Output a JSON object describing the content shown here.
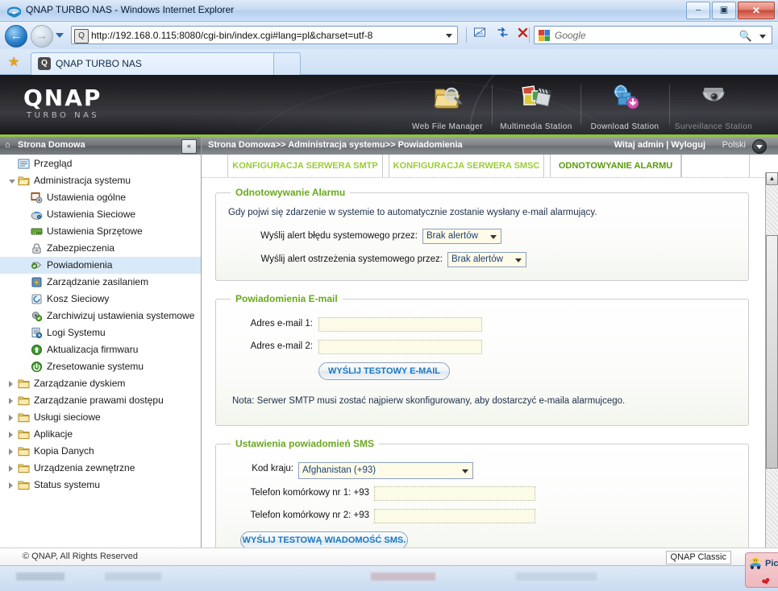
{
  "window": {
    "title": "QNAP TURBO NAS - Windows Internet Explorer",
    "minimize_label": "–",
    "maximize_label": "▣",
    "close_label": "✕"
  },
  "browser": {
    "back_label": "←",
    "forward_label": "→",
    "history_dropdown": "history-dropdown",
    "address_prefix": "http://",
    "address_value": "http://192.168.0.115:8080/cgi-bin/index.cgi#lang=pl&charset=utf-8",
    "address_host": "192.168.0.115",
    "refresh_label": "↻",
    "stop_label": "✕",
    "compat_label": "▩",
    "search_placeholder": "Google",
    "search_icon": "magnifier-icon",
    "tab_label": "QNAP TURBO NAS",
    "tab_icon_letter": "Q",
    "favorites_label": "★",
    "new_tab_label": ""
  },
  "banner": {
    "logo": "QNAP",
    "subtitle": "TURBO NAS",
    "apps": [
      {
        "label": "Web File Manager",
        "icon": "folder-search-icon",
        "dim": false
      },
      {
        "label": "Multimedia Station",
        "icon": "photos-film-icon",
        "dim": false
      },
      {
        "label": "Download Station",
        "icon": "globe-download-icon",
        "dim": false
      },
      {
        "label": "Surveillance Station",
        "icon": "dome-camera-icon",
        "dim": true
      }
    ]
  },
  "sidebar": {
    "header": "Strona Domowa",
    "header_icon": "home-icon",
    "collapse_label": "«",
    "items": [
      {
        "label": "Przegląd",
        "level": 1,
        "icon": "overview-icon",
        "tri": "none",
        "selected": false
      },
      {
        "label": "Administracja systemu",
        "level": 1,
        "icon": "folder-open-icon",
        "tri": "open",
        "selected": false
      },
      {
        "label": "Ustawienia ogólne",
        "level": 2,
        "icon": "general-settings-icon",
        "tri": "none",
        "selected": false
      },
      {
        "label": "Ustawienia Sieciowe",
        "level": 2,
        "icon": "network-settings-icon",
        "tri": "none",
        "selected": false
      },
      {
        "label": "Ustawienia Sprzętowe",
        "level": 2,
        "icon": "hardware-settings-icon",
        "tri": "none",
        "selected": false
      },
      {
        "label": "Zabezpieczenia",
        "level": 2,
        "icon": "lock-icon",
        "tri": "none",
        "selected": false
      },
      {
        "label": "Powiadomienia",
        "level": 2,
        "icon": "notification-icon",
        "tri": "none",
        "selected": true
      },
      {
        "label": "Zarządzanie zasilaniem",
        "level": 2,
        "icon": "power-icon",
        "tri": "none",
        "selected": false
      },
      {
        "label": "Kosz Sieciowy",
        "level": 2,
        "icon": "recycle-bin-icon",
        "tri": "none",
        "selected": false
      },
      {
        "label": "Zarchiwizuj ustawienia systemowe",
        "level": 2,
        "icon": "backup-settings-icon",
        "tri": "none",
        "selected": false
      },
      {
        "label": "Logi Systemu",
        "level": 2,
        "icon": "system-logs-icon",
        "tri": "none",
        "selected": false
      },
      {
        "label": "Aktualizacja firmwaru",
        "level": 2,
        "icon": "firmware-update-icon",
        "tri": "none",
        "selected": false
      },
      {
        "label": "Zresetowanie systemu",
        "level": 2,
        "icon": "system-reset-icon",
        "tri": "none",
        "selected": false
      },
      {
        "label": "Zarządzanie dyskiem",
        "level": 1,
        "icon": "folder-icon",
        "tri": "closed",
        "selected": false
      },
      {
        "label": "Zarządzanie prawami dostępu",
        "level": 1,
        "icon": "folder-icon",
        "tri": "closed",
        "selected": false
      },
      {
        "label": "Usługi sieciowe",
        "level": 1,
        "icon": "folder-icon",
        "tri": "closed",
        "selected": false
      },
      {
        "label": "Aplikacje",
        "level": 1,
        "icon": "folder-icon",
        "tri": "closed",
        "selected": false
      },
      {
        "label": "Kopia Danych",
        "level": 1,
        "icon": "folder-icon",
        "tri": "closed",
        "selected": false
      },
      {
        "label": "Urządzenia zewnętrzne",
        "level": 1,
        "icon": "folder-icon",
        "tri": "closed",
        "selected": false
      },
      {
        "label": "Status systemu",
        "level": 1,
        "icon": "folder-icon",
        "tri": "closed",
        "selected": false
      }
    ],
    "hscroll_left": "◀",
    "hscroll_right": "▶"
  },
  "content_header": {
    "breadcrumb": "Strona Domowa>> Administracja systemu>> Powiadomienia",
    "user_text": "Witaj admin | Wyloguj",
    "language": "Polski"
  },
  "tabs": [
    {
      "label": "KONFIGURACJA SERWERA SMTP",
      "active": false
    },
    {
      "label": "KONFIGURACJA SERWERA SMSC",
      "active": false
    },
    {
      "label": "ODNOTOWYANIE ALARMU",
      "active": true
    }
  ],
  "alarm_section": {
    "legend": "Odnotowywanie Alarmu",
    "description": "Gdy pojwi się zdarzenie w systemie to automatycznie zostanie wysłany e-mail alarmujący.",
    "error_label": "Wyślij alert błędu systemowego przez:",
    "error_value": "Brak alertów",
    "warning_label": "Wyślij alert ostrzeżenia systemowego przez:",
    "warning_value": "Brak alertów"
  },
  "email_section": {
    "legend": "Powiadomienia E-mail",
    "email1_label": "Adres e-mail 1:",
    "email1_value": "",
    "email2_label": "Adres e-mail 2:",
    "email2_value": "",
    "test_button": "WYŚLIJ TESTOWY E-MAIL",
    "note": "Nota: Serwer SMTP musi zostać najpierw skonfigurowany, aby dostarczyć e-maila alarmujcego."
  },
  "sms_section": {
    "legend": "Ustawienia powiadomień SMS",
    "country_label": "Kod kraju:",
    "country_value": "Afghanistan (+93)",
    "phone1_label": "Telefon komórkowy nr 1: +93",
    "phone1_value": "",
    "phone2_label": "Telefon komórkowy nr 2: +93",
    "phone2_value": "",
    "test_button": "WYŚLIJ TESTOWĄ WIADOMOŚĆ SMS."
  },
  "page_footer": {
    "copyright": "© QNAP, All Rights Reserved",
    "theme": "QNAP Classic"
  },
  "popup_fragment": {
    "text": "Pic",
    "icon": "picasa-icon"
  },
  "colors": {
    "accent_green": "#8cc63e",
    "tab_green": "#9acd32",
    "tab_active_green": "#5a9b0c",
    "legend_green": "#6aa81e",
    "link_blue": "#1a78c2",
    "selected_row": "#d8e9f9"
  }
}
